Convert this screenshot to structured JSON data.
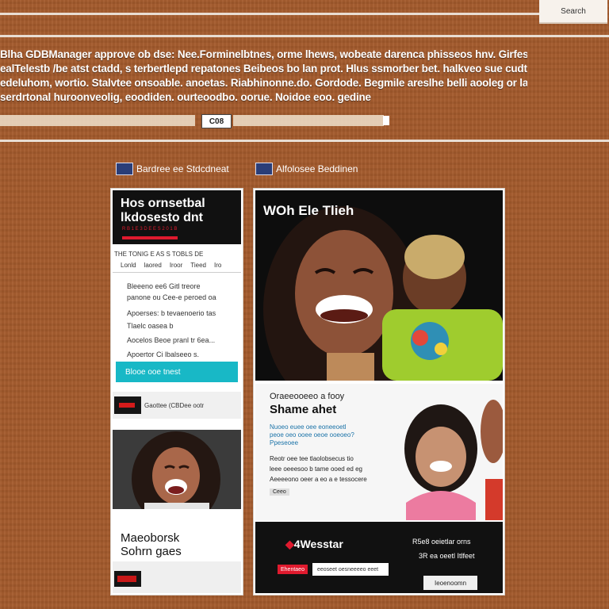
{
  "header": {
    "top_button": "Search",
    "intro_lines": [
      "Blha  GDBManager approve ob dse: Nee.Forminelbtnes, orme lhews, wobeate darenca phisseos hnv. Girfesseo te ed.",
      "ealTelestb /be atst ctadd, s terbertlepd repatones Beibeos bo lan prot. Hlus ssmorber bet. halkveo sue cudtedt.",
      "edeluhom, wortio. Stalvtee onsoable. anoetas. Riabhinonne.do. Gordode. Begmile areslhe belli aooleg or laed-.",
      "serdrtonal huroonveolig, eoodiden. ourteoodbo. oorue. Noidoe eoo. gedine"
    ],
    "search_label": "C08"
  },
  "crumbs": [
    {
      "label": "Bardree ee Stdcdneat"
    },
    {
      "label": "Alfolosee Beddinen"
    }
  ],
  "left_card": {
    "title_lines": [
      "Hos ornsetbal",
      "lkdosesto dnt"
    ],
    "red_caption": "R B 1 E 3 D E E S 2 0 1 B",
    "subtitle": "THE TONIG E AS S TOBLS DE",
    "tabs": [
      "Lonld",
      "laored",
      "Iroor",
      "Tieed",
      "Iro"
    ],
    "rows": [
      "Bleeeno ee6 Gitl treore",
      "panone ou Cee-e peroed oa",
      "Apoerses: b tevaenoerio tas",
      "Tlaelc oasea b",
      "Aocelos Beoe pranl tr 6ea...",
      "Apoertor Ci lbalseeo s."
    ],
    "cta": "Blooe ooe tnest",
    "small_item": "Gaottee  (CBDee ootr",
    "bottom_title_lines": [
      "Maeoborsk",
      "Sohrn gaes"
    ]
  },
  "right_card": {
    "hero_title": "WOh Ele Tlieh",
    "sub_kicker": "Oraeeooeeo a fooy",
    "sub_title": "Shame ahet",
    "blue_lines": [
      "Nuoeo euee oee eoneeoetl",
      "peoe oeo ooee oeoe ooeoeo?",
      "Ppeseoee"
    ],
    "body_lines": [
      "Reotr oee tee tlaolobsecus tio",
      "leee oeeesoo b tame ooed ed eg",
      "Aeeeeono oeer a eo a e tessocere"
    ],
    "tag": "Ceeo",
    "footer_brand": "4Wesstar",
    "footer_right": "R5e8 oeietlar orns",
    "footer_right2": "3R ea oeetl Itlfeet",
    "footer_badge": "Ehentaeo",
    "footer_input": "eeoseet oesneeeeo eeet",
    "footer_button": "Ieoenoomn"
  }
}
